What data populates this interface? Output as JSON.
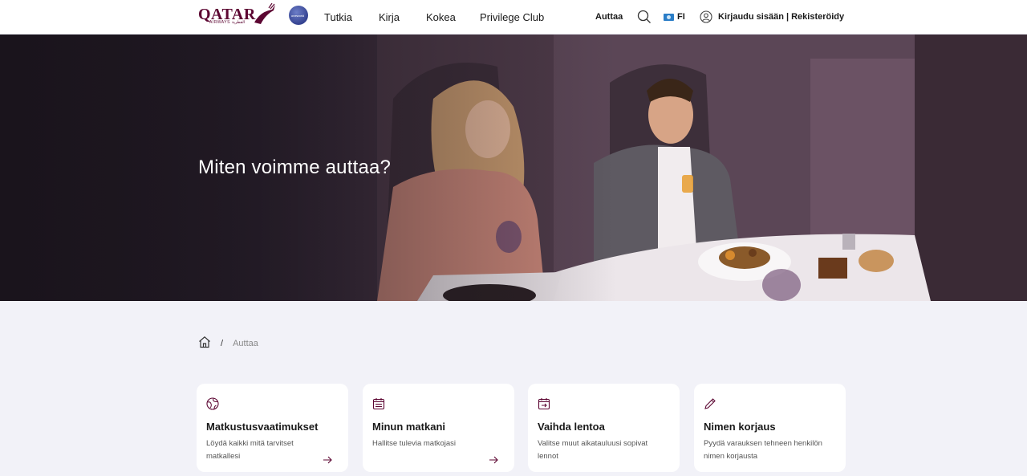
{
  "header": {
    "logo_text": "QATAR",
    "logo_sub": "AIRWAYS القطرية",
    "alliance_badge": "oneworld",
    "nav": [
      "Tutkia",
      "Kirja",
      "Kokea",
      "Privilege Club"
    ],
    "help_link": "Auttaa",
    "language": "FI",
    "account": "Kirjaudu sisään | Rekisteröidy"
  },
  "hero": {
    "title": "Miten voimme auttaa?"
  },
  "breadcrumb": {
    "current": "Auttaa",
    "separator": "/"
  },
  "cards": [
    {
      "icon": "globe-icon",
      "title": "Matkustusvaatimukset",
      "desc": "Löydä kaikki mitä tarvitset matkallesi"
    },
    {
      "icon": "calendar-list-icon",
      "title": "Minun matkani",
      "desc": "Hallitse tulevia matkojasi"
    },
    {
      "icon": "calendar-change-icon",
      "title": "Vaihda lentoa",
      "desc": "Valitse muut aikatauluusi sopivat lennot"
    },
    {
      "icon": "pencil-icon",
      "title": "Nimen korjaus",
      "desc": "Pyydä varauksen tehneen henkilön nimen korjausta"
    }
  ],
  "colors": {
    "brand": "#5c0632",
    "page_bg": "#f2f2f8"
  }
}
